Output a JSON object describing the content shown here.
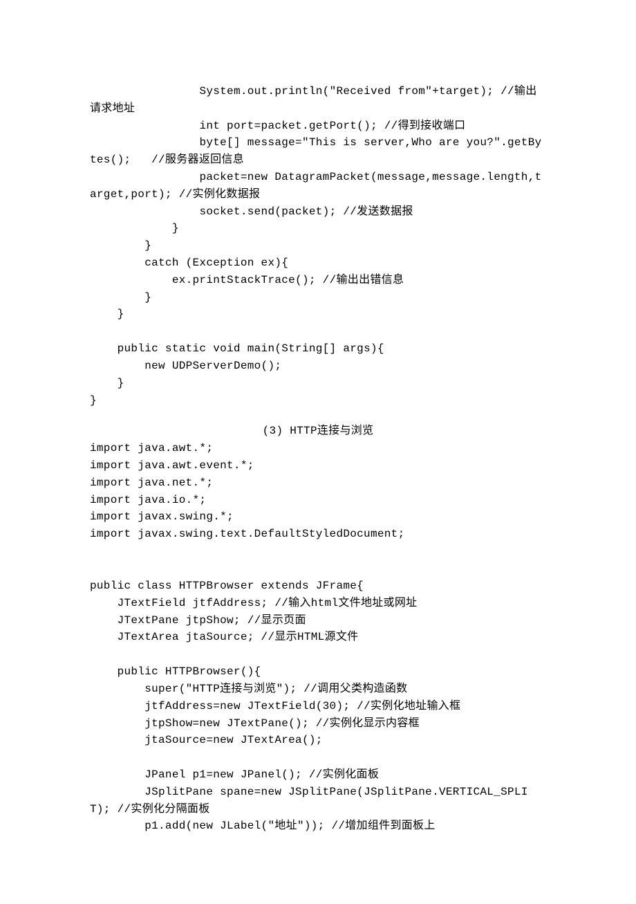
{
  "lines": {
    "l1": "                System.out.println(\"Received from\"+target); //输出请求地址",
    "l2": "                int port=packet.getPort(); //得到接收端口",
    "l3": "                byte[] message=\"This is server,Who are you?\".getBytes();   //服务器返回信息",
    "l4": "                packet=new DatagramPacket(message,message.length,target,port); //实例化数据报",
    "l5": "                socket.send(packet); //发送数据报",
    "l6": "            }",
    "l7": "        }",
    "l8": "        catch (Exception ex){",
    "l9": "            ex.printStackTrace(); //输出出错信息",
    "l10": "        }",
    "l11": "    }",
    "l12": "    public static void main(String[] args){",
    "l13": "        new UDPServerDemo();",
    "l14": "    }",
    "l15": "}",
    "title3": "(3) HTTP连接与浏览",
    "l16": "import java.awt.*;",
    "l17": "import java.awt.event.*;",
    "l18": "import java.net.*;",
    "l19": "import java.io.*;",
    "l20": "import javax.swing.*;",
    "l21": "import javax.swing.text.DefaultStyledDocument;",
    "l22": "public class HTTPBrowser extends JFrame{",
    "l23": "    JTextField jtfAddress; //输入html文件地址或网址",
    "l24": "    JTextPane jtpShow; //显示页面",
    "l25": "    JTextArea jtaSource; //显示HTML源文件",
    "l26": "    public HTTPBrowser(){",
    "l27": "        super(\"HTTP连接与浏览\"); //调用父类构造函数",
    "l28": "        jtfAddress=new JTextField(30); //实例化地址输入框",
    "l29": "        jtpShow=new JTextPane(); //实例化显示内容框",
    "l30": "        jtaSource=new JTextArea();",
    "l31": "        JPanel p1=new JPanel(); //实例化面板",
    "l32": "        JSplitPane spane=new JSplitPane(JSplitPane.VERTICAL_SPLIT); //实例化分隔面板",
    "l33": "        p1.add(new JLabel(\"地址\")); //增加组件到面板上"
  }
}
